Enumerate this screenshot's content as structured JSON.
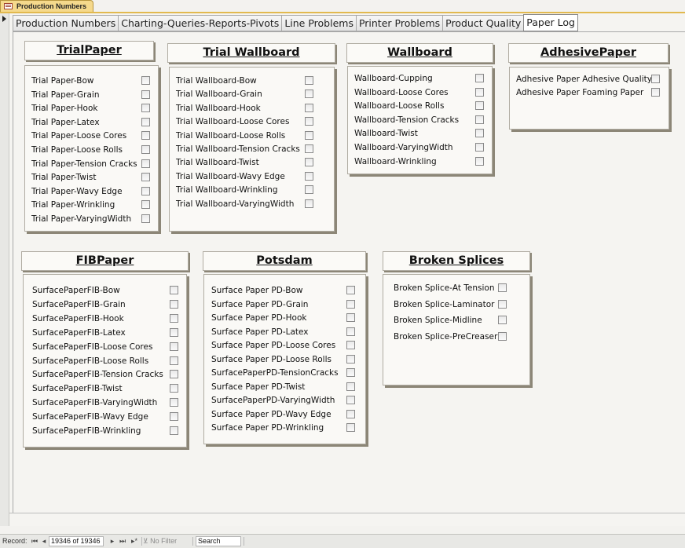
{
  "document_tab": {
    "title": "Production Numbers"
  },
  "tabs": [
    {
      "label": "Production Numbers"
    },
    {
      "label": "Charting-Queries-Reports-Pivots"
    },
    {
      "label": "Line Problems"
    },
    {
      "label": "Printer Problems"
    },
    {
      "label": "Product Quality"
    },
    {
      "label": "Paper Log"
    }
  ],
  "active_tab": "Paper Log",
  "groups": [
    {
      "title": "TrialPaper",
      "items": [
        "Trial Paper-Bow",
        "Trial Paper-Grain",
        "Trial Paper-Hook",
        "Trial Paper-Latex",
        "Trial Paper-Loose Cores",
        "Trial Paper-Loose Rolls",
        "Trial Paper-Tension Cracks",
        "Trial Paper-Twist",
        "Trial Paper-Wavy Edge",
        "Trial Paper-Wrinkling",
        "Trial Paper-VaryingWidth"
      ]
    },
    {
      "title": "Trial Wallboard",
      "items": [
        "Trial Wallboard-Bow",
        "Trial Wallboard-Grain",
        "Trial Wallboard-Hook",
        "Trial Wallboard-Loose Cores",
        "Trial Wallboard-Loose Rolls",
        "Trial Wallboard-Tension Cracks",
        "Trial Wallboard-Twist",
        "Trial Wallboard-Wavy Edge",
        "Trial Wallboard-Wrinkling",
        "Trial Wallboard-VaryingWidth"
      ]
    },
    {
      "title": "Wallboard",
      "items": [
        "Wallboard-Cupping",
        "Wallboard-Loose Cores",
        "Wallboard-Loose Rolls",
        "Wallboard-Tension Cracks",
        "Wallboard-Twist",
        "Wallboard-VaryingWidth",
        "Wallboard-Wrinkling"
      ]
    },
    {
      "title": "AdhesivePaper",
      "items": [
        "Adhesive Paper Adhesive Quality",
        "Adhesive Paper Foaming Paper"
      ]
    },
    {
      "title": "FIBPaper",
      "items": [
        "SurfacePaperFIB-Bow",
        "SurfacePaperFIB-Grain",
        "SurfacePaperFIB-Hook",
        "SurfacePaperFIB-Latex",
        "SurfacePaperFIB-Loose Cores",
        "SurfacePaperFIB-Loose Rolls",
        "SurfacePaperFIB-Tension Cracks",
        "SurfacePaperFIB-Twist",
        "SurfacePaperFIB-VaryingWidth",
        "SurfacePaperFIB-Wavy Edge",
        "SurfacePaperFIB-Wrinkling"
      ]
    },
    {
      "title": "Potsdam",
      "items": [
        "Surface Paper PD-Bow",
        "Surface Paper PD-Grain",
        "Surface Paper PD-Hook",
        "Surface Paper PD-Latex",
        "Surface Paper PD-Loose Cores",
        "Surface Paper PD-Loose Rolls",
        "SurfacePaperPD-TensionCracks",
        "Surface Paper PD-Twist",
        "SurfacePaperPD-VaryingWidth",
        "Surface Paper PD-Wavy Edge",
        "Surface Paper PD-Wrinkling"
      ]
    },
    {
      "title": "Broken Splices",
      "items": [
        "Broken Splice-At Tension",
        "Broken Splice-Laminator",
        "Broken Splice-Midline",
        "Broken Splice-PreCreaser"
      ]
    }
  ],
  "status_bar": {
    "record_label": "Record:",
    "record_value": "19346 of 19346",
    "nav_first": "⏮",
    "nav_prev": "◂",
    "nav_next": "▸",
    "nav_last": "⏭",
    "nav_new": "▸*",
    "filter_label": "No Filter",
    "search_label": "Search"
  },
  "icons": {
    "doc_tab_icon": "form-icon",
    "record_selector_icon": "triangle-right-icon",
    "filter_icon": "funnel-x-icon"
  }
}
